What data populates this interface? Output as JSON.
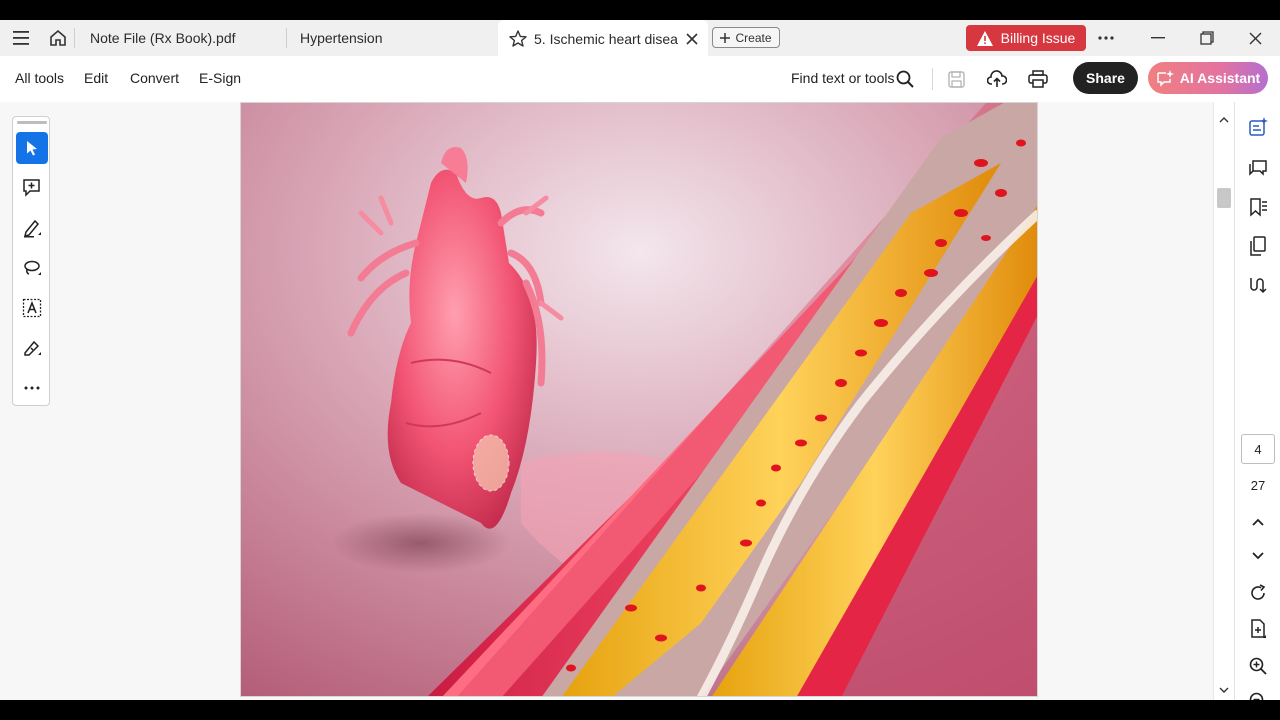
{
  "tabs": [
    {
      "label": "Note File (Rx Book).pdf"
    },
    {
      "label": "Hypertension"
    },
    {
      "label": "5. Ischemic heart diseas..."
    }
  ],
  "create_label": "Create",
  "billing_label": "Billing Issue",
  "toolbar": {
    "menu": [
      "All tools",
      "Edit",
      "Convert",
      "E-Sign"
    ],
    "find_label": "Find text or tools",
    "share_label": "Share",
    "ai_label": "AI Assistant"
  },
  "page_nav": {
    "current": "4",
    "total": "27"
  },
  "colors": {
    "accent": "#1473e6",
    "billing": "#d7373f",
    "share": "#222222"
  },
  "icons": {
    "left_tools": [
      "select-arrow-icon",
      "add-comment-icon",
      "highlight-pen-icon",
      "lasso-draw-icon",
      "text-recognition-icon",
      "sign-pen-icon",
      "more-icon"
    ],
    "right_panel": [
      "ai-generate-icon",
      "comments-icon",
      "bookmark-icon",
      "pages-icon",
      "links-icon"
    ]
  }
}
